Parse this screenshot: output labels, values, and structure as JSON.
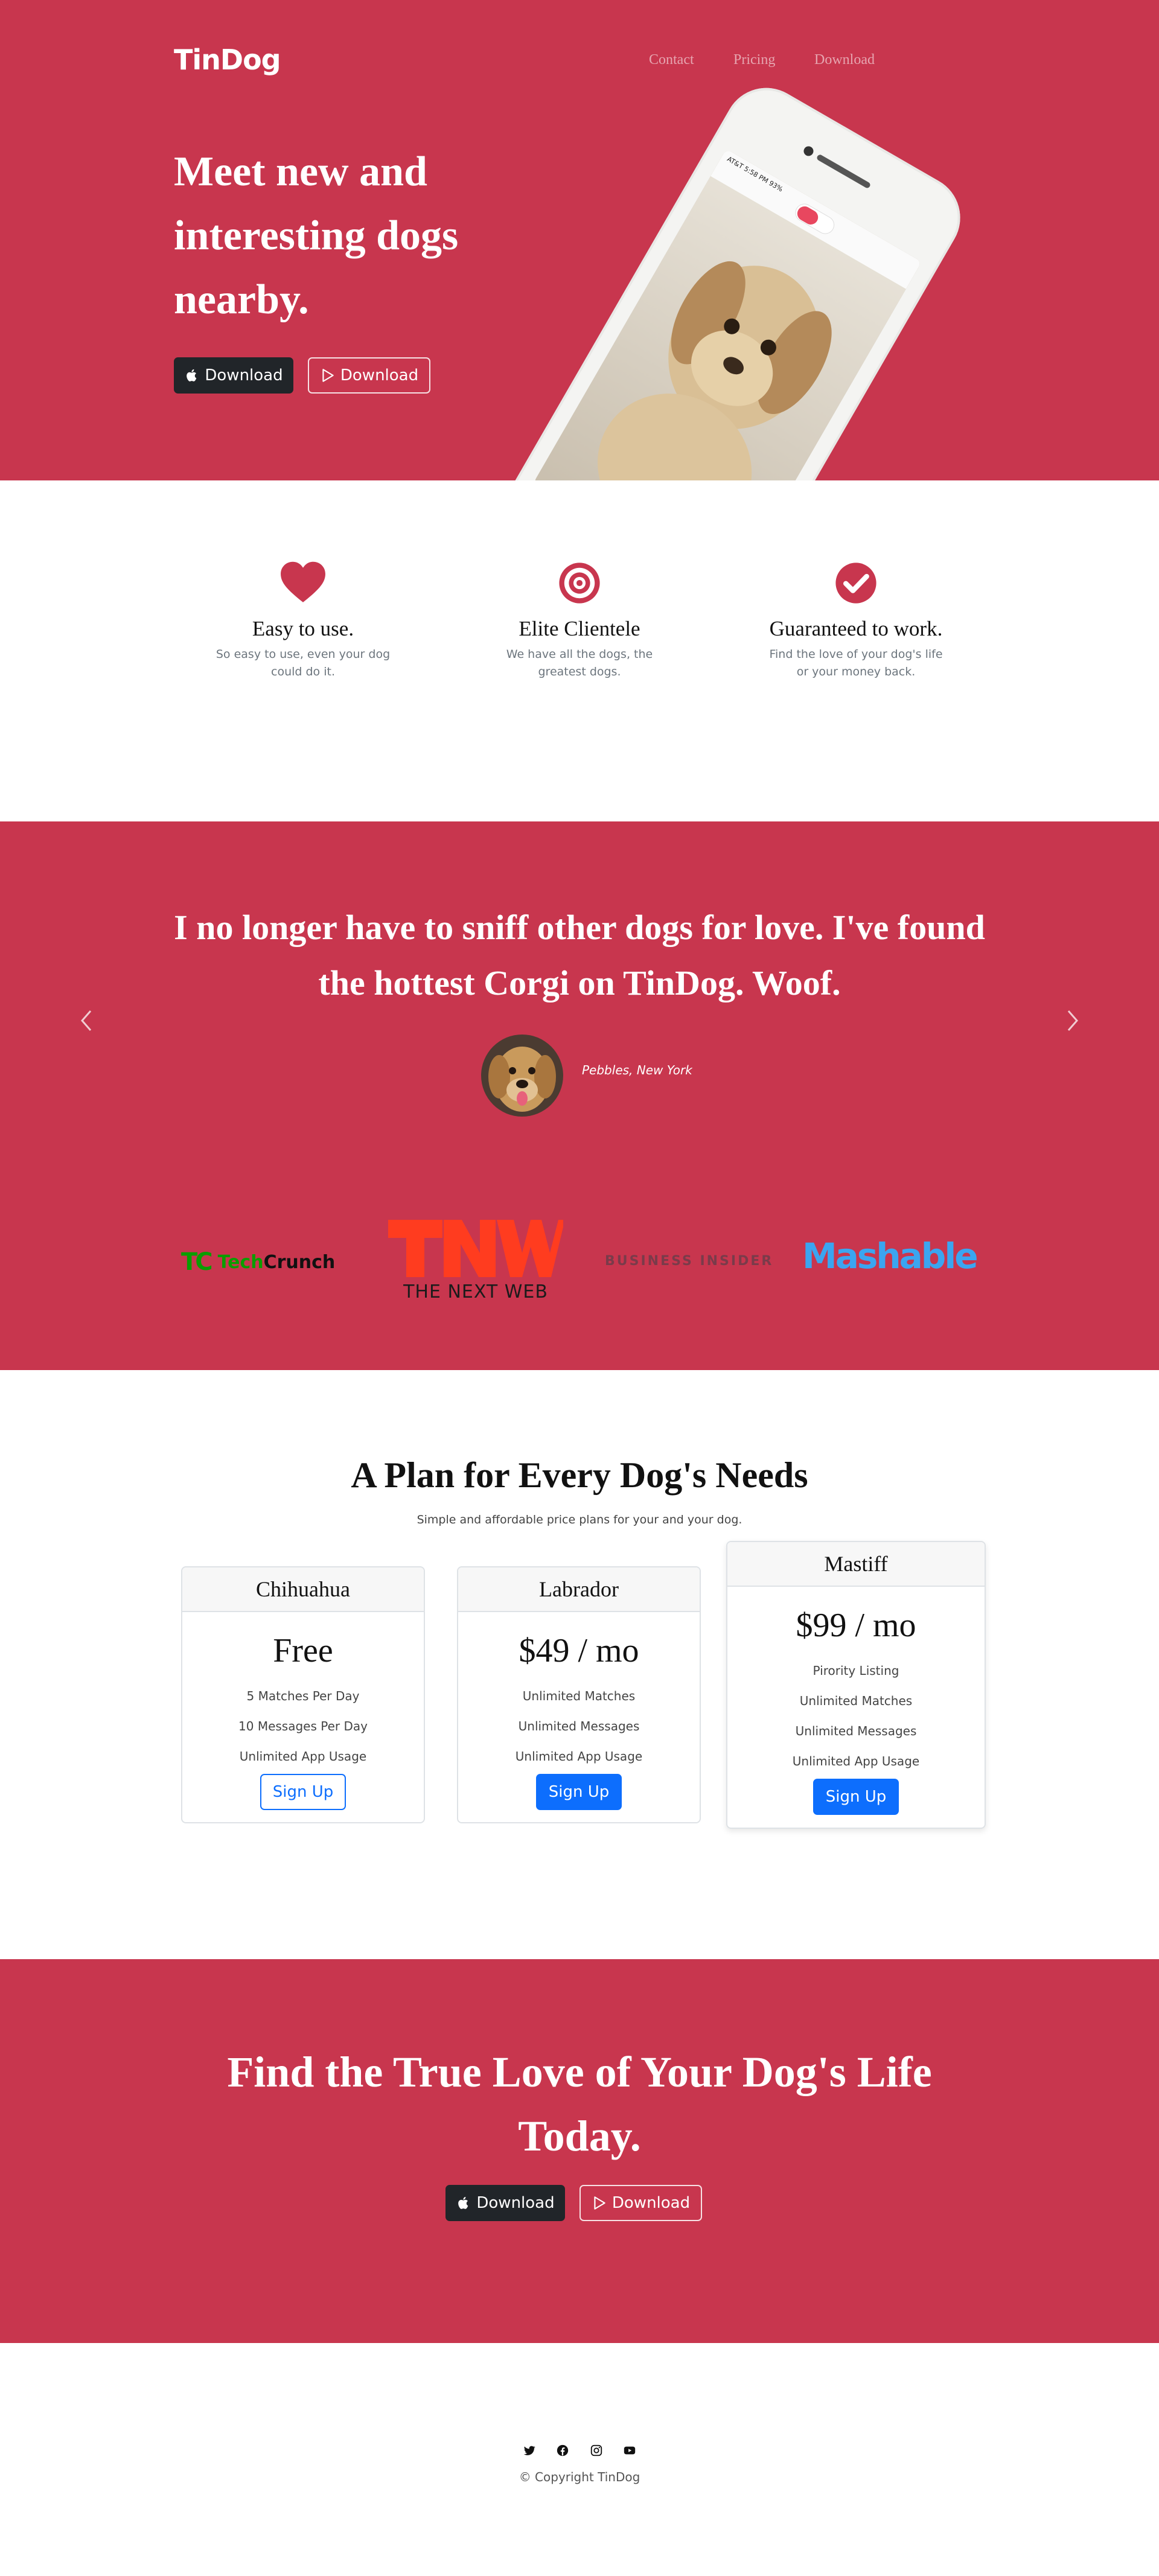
{
  "colors": {
    "brand": "#c8364e",
    "dark": "#212529",
    "primary": "#0d6efd"
  },
  "nav": {
    "brand": "TinDog",
    "links": [
      "Contact",
      "Pricing",
      "Download"
    ]
  },
  "hero": {
    "title": "Meet new and interesting dogs nearby.",
    "apple_button": "Download",
    "google_button": "Download",
    "phone_status": "AT&T  5:58 PM  93%"
  },
  "features": [
    {
      "icon": "heart-icon",
      "title": "Easy to use.",
      "text": "So easy to use, even your dog could do it."
    },
    {
      "icon": "bullseye-icon",
      "title": "Elite Clientele",
      "text": "We have all the dogs, the greatest dogs."
    },
    {
      "icon": "check-circle-icon",
      "title": "Guaranteed to work.",
      "text": "Find the love of your dog's life or your money back."
    }
  ],
  "testimonial": {
    "quote": "I no longer have to sniff other dogs for love. I've found the hottest Corgi on TinDog. Woof.",
    "author": "Pebbles, New York"
  },
  "press": {
    "techcrunch_tc": "TC",
    "techcrunch_tech": "Tech",
    "techcrunch_crunch": "Crunch",
    "tnw_sub": "THE NEXT WEB",
    "business_insider": "BUSINESS INSIDER",
    "mashable": "Mashable"
  },
  "pricing": {
    "title": "A Plan for Every Dog's Needs",
    "subtitle": "Simple and affordable price plans for your and your dog.",
    "plans": [
      {
        "name": "Chihuahua",
        "price": "Free",
        "features": [
          "5 Matches Per Day",
          "10 Messages Per Day",
          "Unlimited App Usage"
        ],
        "button": "Sign Up"
      },
      {
        "name": "Labrador",
        "price": "$49 / mo",
        "features": [
          "Unlimited Matches",
          "Unlimited Messages",
          "Unlimited App Usage"
        ],
        "button": "Sign Up"
      },
      {
        "name": "Mastiff",
        "price": "$99 / mo",
        "features": [
          "Pirority Listing",
          "Unlimited Matches",
          "Unlimited Messages",
          "Unlimited App Usage"
        ],
        "button": "Sign Up"
      }
    ]
  },
  "cta": {
    "title": "Find the True Love of Your Dog's Life Today.",
    "apple_button": "Download",
    "google_button": "Download"
  },
  "footer": {
    "socials": [
      "twitter-icon",
      "facebook-icon",
      "instagram-icon",
      "youtube-icon"
    ],
    "copyright": "© Copyright TinDog"
  }
}
